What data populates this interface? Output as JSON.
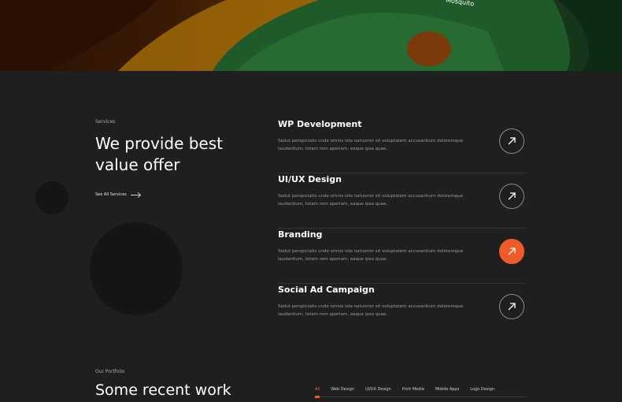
{
  "hero": {
    "curved_text": "Mosquito"
  },
  "services": {
    "eyebrow": "Services",
    "headline_line1": "We provide best",
    "headline_line2": "value offer",
    "see_all": "See All Services",
    "items": [
      {
        "title": "WP Development",
        "desc": "Sedut perspiciatis unde omnis iste natusrror sit voluptatem accusantium doloremque laudantium, totam rem aperiam, eaque ipsa quae.",
        "icon": "arrow-up-right-icon",
        "active": false
      },
      {
        "title": "UI/UX Design",
        "desc": "Sedut perspiciatis unde omnis iste natusrror sit voluptatem accusantium doloremque laudantium, totam rem aperiam, eaque ipsa quae.",
        "icon": "arrow-up-right-icon",
        "active": false
      },
      {
        "title": "Branding",
        "desc": "Sedut perspiciatis unde omnis iste natusrror sit voluptatem accusantium doloremque laudantium, totam rem aperiam, eaque ipsa quae.",
        "icon": "arrow-up-right-icon",
        "active": true
      },
      {
        "title": "Social Ad Campaign",
        "desc": "Sedut perspiciatis unde omnis iste natusrror sit voluptatem accusantium doloremque laudantium, totam rem aperiam, eaque ipsa quae.",
        "icon": "arrow-up-right-icon",
        "active": false
      }
    ]
  },
  "portfolio": {
    "eyebrow": "Our Portfolio",
    "title": "Some recent work",
    "filters": [
      "All",
      "Web Design",
      "UI/UX Design",
      "Print Media",
      "Mobile Apps",
      "Logo Design"
    ]
  },
  "colors": {
    "accent": "#f05a28",
    "background": "#1f1f1f"
  }
}
